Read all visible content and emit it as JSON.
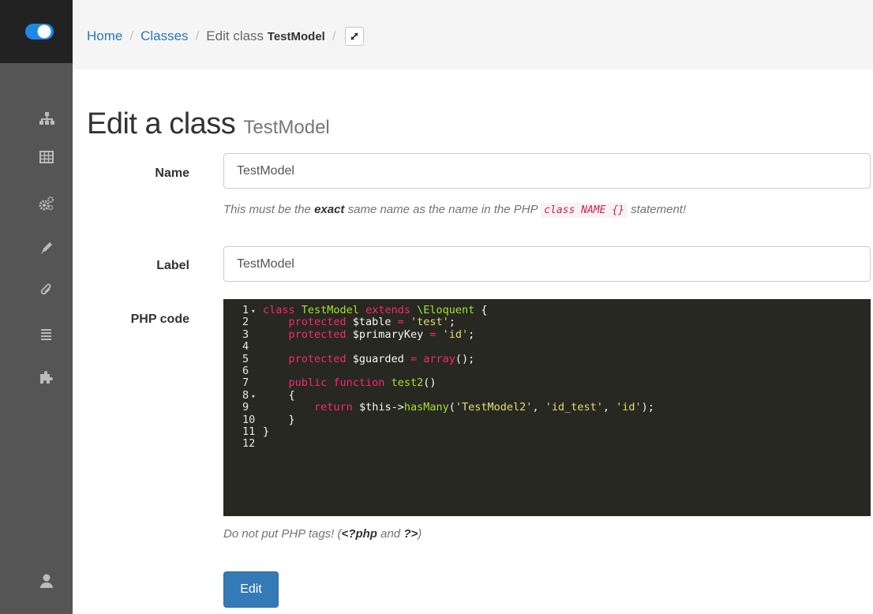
{
  "breadcrumb": {
    "home": "Home",
    "classes": "Classes",
    "current_prefix": "Edit class",
    "current_name": "TestModel",
    "separator": "/"
  },
  "title": {
    "main": "Edit a class",
    "sub": "TestModel"
  },
  "form": {
    "name_label": "Name",
    "name_value": "TestModel",
    "name_help_pre": "This must be the",
    "name_help_bold": "exact",
    "name_help_mid": "same name as the name in the PHP",
    "name_help_code": "class NAME {}",
    "name_help_post": "statement!",
    "label_label": "Label",
    "label_value": "TestModel",
    "code_label": "PHP code",
    "code_help_pre": "Do not put PHP tags! (",
    "code_help_b1": "<?php",
    "code_help_mid": " and ",
    "code_help_b2": "?>",
    "code_help_post": ")",
    "submit_label": "Edit"
  },
  "code_lines": [
    {
      "n": "1",
      "fold": "▾",
      "tokens": [
        [
          "kw",
          "class "
        ],
        [
          "cls",
          "TestModel "
        ],
        [
          "kw",
          "extends "
        ],
        [
          "cls",
          "\\Eloquent "
        ],
        [
          "code",
          "{"
        ]
      ]
    },
    {
      "n": "2",
      "fold": "",
      "tokens": [
        [
          "code",
          "    "
        ],
        [
          "kw",
          "protected "
        ],
        [
          "var",
          "$table "
        ],
        [
          "kw",
          "= "
        ],
        [
          "str",
          "'test'"
        ],
        [
          "code",
          ";"
        ]
      ]
    },
    {
      "n": "3",
      "fold": "",
      "tokens": [
        [
          "code",
          "    "
        ],
        [
          "kw",
          "protected "
        ],
        [
          "var",
          "$primaryKey "
        ],
        [
          "kw",
          "= "
        ],
        [
          "str",
          "'id'"
        ],
        [
          "code",
          ";"
        ]
      ]
    },
    {
      "n": "4",
      "fold": "",
      "tokens": []
    },
    {
      "n": "5",
      "fold": "",
      "tokens": [
        [
          "code",
          "    "
        ],
        [
          "kw",
          "protected "
        ],
        [
          "var",
          "$guarded "
        ],
        [
          "kw",
          "= array"
        ],
        [
          "code",
          "();"
        ]
      ]
    },
    {
      "n": "6",
      "fold": "",
      "tokens": []
    },
    {
      "n": "7",
      "fold": "",
      "tokens": [
        [
          "code",
          "    "
        ],
        [
          "kw",
          "public function "
        ],
        [
          "fn",
          "test2"
        ],
        [
          "code",
          "()"
        ]
      ]
    },
    {
      "n": "8",
      "fold": "▾",
      "tokens": [
        [
          "code",
          "    {"
        ]
      ]
    },
    {
      "n": "9",
      "fold": "",
      "tokens": [
        [
          "code",
          "        "
        ],
        [
          "kw",
          "return "
        ],
        [
          "var",
          "$this"
        ],
        [
          "code",
          "->"
        ],
        [
          "fn",
          "hasMany"
        ],
        [
          "code",
          "("
        ],
        [
          "str",
          "'TestModel2'"
        ],
        [
          "code",
          ", "
        ],
        [
          "str",
          "'id_test'"
        ],
        [
          "code",
          ", "
        ],
        [
          "str",
          "'id'"
        ],
        [
          "code",
          ");"
        ]
      ]
    },
    {
      "n": "10",
      "fold": "",
      "tokens": [
        [
          "code",
          "    }"
        ]
      ]
    },
    {
      "n": "11",
      "fold": "",
      "tokens": [
        [
          "code",
          "}"
        ]
      ]
    },
    {
      "n": "12",
      "fold": "",
      "tokens": []
    }
  ],
  "sidebar": {
    "items": [
      {
        "name": "sitemap-icon"
      },
      {
        "name": "table-icon"
      },
      {
        "name": "cogs-icon"
      },
      {
        "name": "pencil-icon"
      },
      {
        "name": "paperclip-icon"
      },
      {
        "name": "list-icon"
      },
      {
        "name": "puzzle-icon"
      },
      {
        "name": "user-icon"
      }
    ]
  },
  "colors": {
    "sidebar": "#555555",
    "brand": "#222222",
    "link": "#2a78b8",
    "primary_button": "#337ab7",
    "editor_bg": "#272822"
  }
}
